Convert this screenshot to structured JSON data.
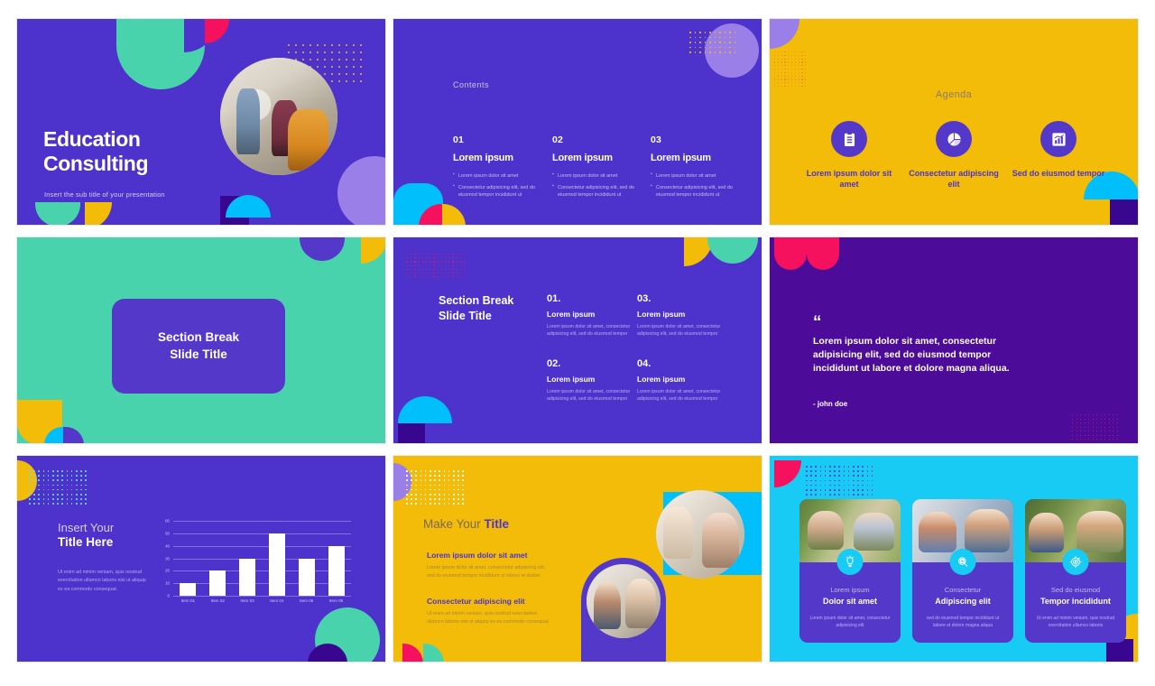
{
  "palette": {
    "purple": "#4D33CC",
    "purple_deep": "#4C0B99",
    "purple_light": "#9A7FE8",
    "yellow": "#F2BC08",
    "teal": "#49D3AD",
    "cyan": "#17CBF5",
    "pink": "#F5115E",
    "white": "#FFFFFF"
  },
  "slides": [
    {
      "id": "title-slide",
      "title_line1": "Education",
      "title_line2": "Consulting",
      "subtitle": "Insert the sub title of your presentation",
      "photo": "people-meeting-vr-workshop"
    },
    {
      "id": "contents-slide",
      "label": "Contents",
      "columns": [
        {
          "number": "01",
          "heading": "Lorem ipsum",
          "bullets": [
            "Lorem ipsum dolor sit amet",
            "Consectetur adipisicing elit, sed do eiusmod tempor incididunt ut"
          ]
        },
        {
          "number": "02",
          "heading": "Lorem ipsum",
          "bullets": [
            "Lorem ipsum dolor sit amet",
            "Consectetur adipisicing elit, sed do eiusmod tempor incididunt ut"
          ]
        },
        {
          "number": "03",
          "heading": "Lorem ipsum",
          "bullets": [
            "Lorem ipsum dolor sit amet",
            "Consectetur adipisicing elit, sed do eiusmod tempor incididunt ut"
          ]
        }
      ]
    },
    {
      "id": "agenda-slide",
      "title": "Agenda",
      "items": [
        {
          "icon": "clipboard-checklist-icon",
          "caption": "Lorem ipsum dolor sit amet"
        },
        {
          "icon": "pie-chart-icon",
          "caption": "Consectetur adipiscing elit"
        },
        {
          "icon": "bar-chart-growth-icon",
          "caption": "Sed do eiusmod tempor"
        }
      ]
    },
    {
      "id": "section-break-slide",
      "title_line1": "Section Break",
      "title_line2": "Slide Title"
    },
    {
      "id": "section-break-list-slide",
      "title_line1": "Section Break",
      "title_line2": "Slide Title",
      "items": [
        {
          "number": "01.",
          "heading": "Lorem ipsum",
          "body": "Lorem ipsum dolor sit amet, consectetur adipisicing elit, sed do eiusmod tempor"
        },
        {
          "number": "02.",
          "heading": "Lorem ipsum",
          "body": "Lorem ipsum dolor sit amet, consectetur adipisicing elit, sed do eiusmod tempor"
        },
        {
          "number": "03.",
          "heading": "Lorem ipsum",
          "body": "Lorem ipsum dolor sit amet, consectetur adipisicing elit, sed do eiusmod tempor"
        },
        {
          "number": "04.",
          "heading": "Lorem ipsum",
          "body": "Lorem ipsum dolor sit amet, consectetur adipisicing elit, sed do eiusmod tempor"
        }
      ]
    },
    {
      "id": "quote-slide",
      "quote_mark": "“",
      "quote": "Lorem ipsum dolor sit amet, consectetur adipisicing elit, sed do eiusmod tempor incididunt ut labore et dolore magna aliqua.",
      "author": "- john doe"
    },
    {
      "id": "chart-slide",
      "title_line1": "Insert Your",
      "title_line2": "Title Here",
      "body": "Ut enim ad minim veniam, quis nostrud exercitation ullamco laboris nisi ut aliquip ex ea commodo consequat."
    },
    {
      "id": "make-your-title-slide",
      "title_plain": "Make Your ",
      "title_accent": "Title",
      "blocks": [
        {
          "heading": "Lorem ipsum dolor sit amet",
          "body": "Lorem ipsum dolor sit amet, consectetur adipiscing elit, sed do eiusmod tempor incididunt ut labore et dolore"
        },
        {
          "heading": "Consectetur adipiscing elit",
          "body": "Ut enim ad minim veniam, quis nostrud exercitation ullamco laboris nisi ut aliquip ex ea commodo consequat"
        }
      ],
      "photos": [
        "classroom-teacher-with-children",
        "family-mother-with-children"
      ]
    },
    {
      "id": "three-cards-slide",
      "cards": [
        {
          "icon": "lightbulb-icon",
          "kicker": "Lorem ipsum",
          "title": "Dolor sit amet",
          "text": "Lorem ipsum dolor sit amet, consectetur adipisicing elit",
          "photo": "kids-playing-outdoors"
        },
        {
          "icon": "network-search-icon",
          "kicker": "Consectetur",
          "title": "Adipiscing elit",
          "text": "sed do eiusmod tempor incididunt ut labore et dolore magna aliqua",
          "photo": "kids-playing-with-blocks"
        },
        {
          "icon": "target-dartboard-icon",
          "kicker": "Sed do eiusmod",
          "title": "Tempor incididunt",
          "text": "Ut enim ad minim veniam, quis nostrud exercitation ullamco laboris",
          "photo": "group-of-smiling-kids"
        }
      ]
    }
  ],
  "chart_data": {
    "type": "bar",
    "title": "",
    "categories": [
      "Item 01",
      "Item 02",
      "Item 03",
      "Item 04",
      "Item 05",
      "Item 06"
    ],
    "values": [
      10,
      20,
      30,
      50,
      30,
      40
    ],
    "xlabel": "",
    "ylabel": "",
    "ylim": [
      0,
      60
    ],
    "yticks": [
      0,
      10,
      20,
      30,
      40,
      50,
      60
    ],
    "grid": true,
    "legend": false,
    "bar_color": "#FFFFFF",
    "background": "#4D33CC"
  }
}
